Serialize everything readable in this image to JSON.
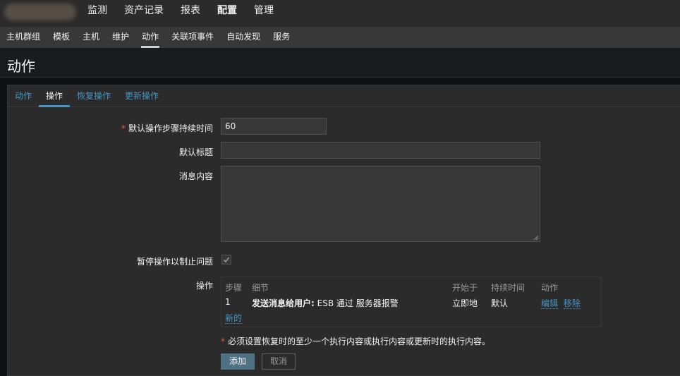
{
  "top_menu": [
    "监测",
    "资产记录",
    "报表",
    "配置",
    "管理"
  ],
  "sub_menu": [
    "主机群组",
    "模板",
    "主机",
    "维护",
    "动作",
    "关联项事件",
    "自动发现",
    "服务"
  ],
  "page": {
    "title": "动作"
  },
  "tabs": [
    "动作",
    "操作",
    "恢复操作",
    "更新操作"
  ],
  "form": {
    "step_duration_label": "默认操作步骤持续时间",
    "step_duration_value": "60",
    "subject_label": "默认标题",
    "subject_value": "",
    "message_label": "消息内容",
    "message_value": "",
    "pause_label": "暂停操作以制止问题",
    "pause_checked": true,
    "operations_label": "操作"
  },
  "operations": {
    "headers": [
      "步骤",
      "细节",
      "开始于",
      "持续时间",
      "动作"
    ],
    "rows": [
      {
        "step": "1",
        "detail_prefix": "发送消息给用户:",
        "detail_rest": " ESB 通过 服务器报警",
        "start": "立即地",
        "duration": "默认",
        "edit": "编辑",
        "remove": "移除"
      }
    ],
    "new_link": "新的"
  },
  "note": "必须设置恢复时的至少一个执行内容或执行内容或更新时的执行内容。",
  "buttons": {
    "add": "添加",
    "cancel": "取消"
  },
  "colors": {
    "accent": "#4796c4",
    "required": "#e45959",
    "primary_button": "#4f7283"
  }
}
